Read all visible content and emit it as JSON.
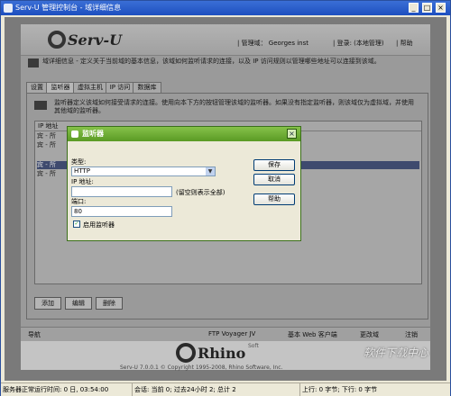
{
  "window": {
    "title": "Serv-U 管理控制台 - 域详细信息"
  },
  "header": {
    "logo_text": "Serv-U",
    "links": [
      {
        "label": "| 管理域： Georges inst"
      },
      {
        "label": "| 登录: (本地管理)"
      },
      {
        "label": "| 帮助"
      }
    ]
  },
  "info": {
    "heading": "域详细信息",
    "text": "域详细信息 - 定义关于当前域的基本信息，该域如何监听请求的连接，以及 IP 访问规则以管理哪些地址可以连接到该域。"
  },
  "tabs": [
    "设置",
    "监听器",
    "虚拟主机",
    "IP 访问",
    "数据库"
  ],
  "listener_panel": {
    "description": "监听器定义该域如何接受请求的连接。使用向本下方的按钮管理该域的监听器。如果没有指定监听器，则该域仅为虚拟域，并使用其他域的监听器。",
    "header": "IP 地址",
    "rows": [
      "宾 - 所",
      "宾 - 所",
      "宾 - 所",
      "宾 - 所"
    ],
    "buttons": {
      "add": "添加",
      "edit": "编辑",
      "delete": "删除"
    }
  },
  "navstrip": {
    "nav": "导航",
    "items": [
      "FTP Voyager JV",
      "基本 Web 客户端",
      "更改域",
      "注销"
    ]
  },
  "footer": {
    "brand": "Rhino",
    "brand_sup": "Soft",
    "copyright": "Serv-U 7.0.0.1 © Copyright 1995-2008, Rhino Software, Inc."
  },
  "dialog": {
    "title": "监听器",
    "type_label": "类型:",
    "type_value": "HTTP",
    "ip_label": "IP 地址:",
    "ip_value": "",
    "ip_hint": "(留空则表示全部)",
    "port_label": "端口:",
    "port_value": "80",
    "enable_label": "启用监听器",
    "enable_checked": true,
    "buttons": {
      "save": "保存",
      "cancel": "取消",
      "help": "帮助"
    }
  },
  "statusbar": {
    "uptime": "服务器正常运行时间: 0 日, 03:54:00",
    "sessions": "会话: 当前 0; 过去24小时 2; 总计 2",
    "transfer": "上行: 0 字节; 下行: 0 字节"
  },
  "watermark": "软件下载中心",
  "colors": {
    "title_blue": "#1d4fbf",
    "dialog_green": "#5a9a24"
  }
}
